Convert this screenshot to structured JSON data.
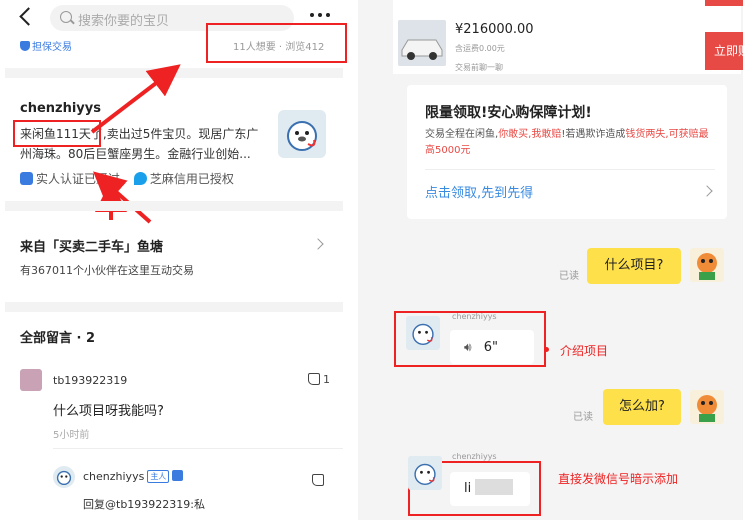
{
  "left": {
    "search_placeholder": "搜索你要的宝贝",
    "guarantee": "担保交易",
    "stats": "11人想要 · 浏览412",
    "seller": {
      "name": "chenzhiyys",
      "desc_line1": "来闲鱼111天了,卖出过5件宝贝。现居广东广",
      "desc_line2": "州海珠。80后巨蟹座男生。金融行业创始...",
      "verify_real": "实人认证已通过",
      "verify_zm": "芝麻信用已授权"
    },
    "pond": {
      "title": "来自「买卖二手车」鱼塘",
      "sub": "有367011个小伙伴在这里互动交易"
    },
    "comments": {
      "title": "全部留言 · 2",
      "first": {
        "user": "tb193922319",
        "likes": "1",
        "text": "什么项目呀我能吗?",
        "time": "5小时前"
      },
      "reply": {
        "user": "chenzhiyys",
        "tag": "主人",
        "text": "回复@tb193922319:私"
      }
    }
  },
  "right": {
    "product": {
      "price": "¥216000.00",
      "shipping": "含运费0.00元",
      "chat_before": "交易前聊一聊",
      "buy": "立即购买"
    },
    "promo": {
      "title": "限量领取!安心购保障计划!",
      "body_a": "交易全程在闲鱼,",
      "body_b": "你敢买,我敢赔",
      "body_c": "!若遇欺诈造成",
      "body_d": "钱货两失,可获赔最高5000元",
      "link": "点击领取,先到先得"
    },
    "chat": {
      "read": "已读",
      "msg1": "什么项目?",
      "seller_name": "chenzhiyys",
      "voice": "6\"",
      "annot_voice": "介绍项目",
      "msg2": "怎么加?",
      "reply_text": "li",
      "annot_wechat": "直接发微信号暗示添加"
    }
  },
  "colors": {
    "accent_red": "#e74a45",
    "annotation_red": "#ee2222",
    "bubble_yellow": "#fde04a",
    "link_blue": "#3a8be0"
  }
}
